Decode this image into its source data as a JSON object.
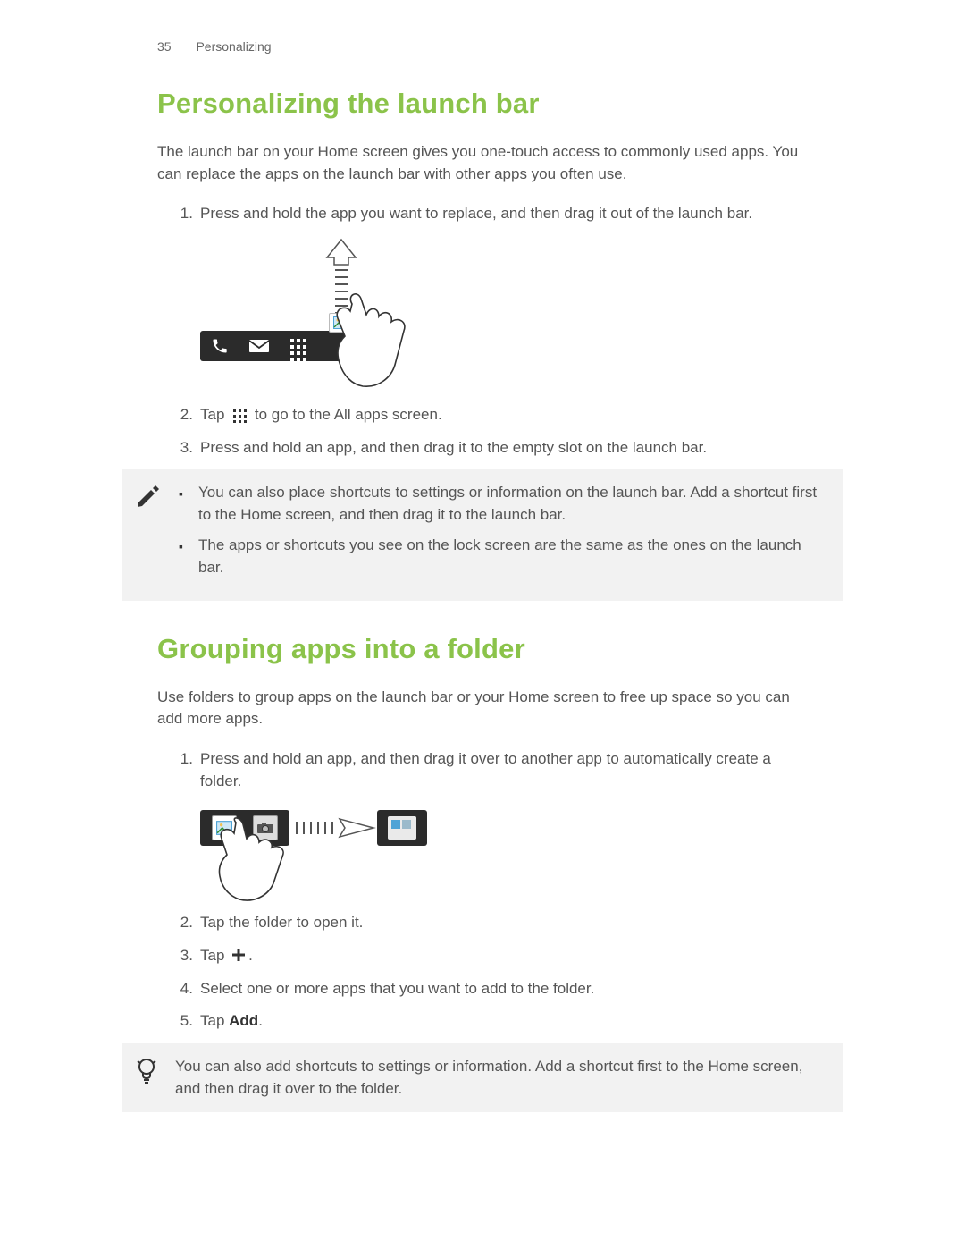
{
  "header": {
    "page_number": "35",
    "section": "Personalizing"
  },
  "section1": {
    "title": "Personalizing the launch bar",
    "intro": "The launch bar on your Home screen gives you one-touch access to commonly used apps. You can replace the apps on the launch bar with other apps you often use.",
    "steps": {
      "s1": "Press and hold the app you want to replace, and then drag it out of the launch bar.",
      "s2_pre": "Tap ",
      "s2_post": " to go to the All apps screen.",
      "s3": "Press and hold an app, and then drag it to the empty slot on the launch bar."
    },
    "note": {
      "b1": "You can also place shortcuts to settings or information on the launch bar. Add a shortcut first to the Home screen, and then drag it to the launch bar.",
      "b2": "The apps or shortcuts you see on the lock screen are the same as the ones on the launch bar."
    }
  },
  "section2": {
    "title": "Grouping apps into a folder",
    "intro": "Use folders to group apps on the launch bar or your Home screen to free up space so you can add more apps.",
    "steps": {
      "s1": "Press and hold an app, and then drag it over to another app to automatically create a folder.",
      "s2": "Tap the folder to open it.",
      "s3_pre": "Tap ",
      "s3_post": ".",
      "s4": "Select one or more apps that you want to add to the folder.",
      "s5_pre": "Tap ",
      "s5_bold": "Add",
      "s5_post": "."
    },
    "tip": "You can also add shortcuts to settings or information. Add a shortcut first to the Home screen, and then drag it over to the folder."
  }
}
